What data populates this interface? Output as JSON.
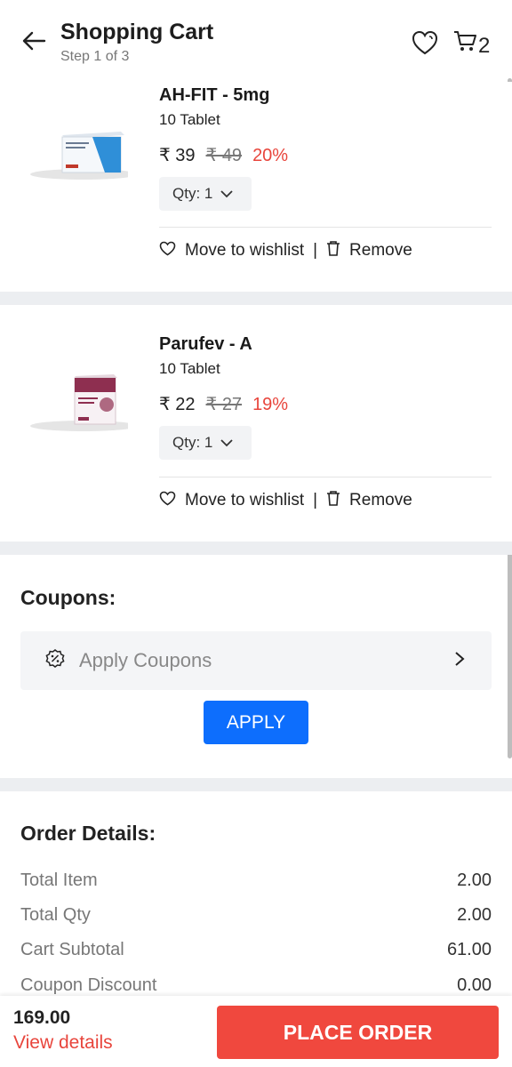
{
  "header": {
    "title": "Shopping Cart",
    "step": "Step 1 of 3",
    "cart_count": "2",
    "icons": [
      "back-arrow-icon",
      "heart-icon",
      "cart-icon"
    ]
  },
  "items": [
    {
      "name": "AH-FIT - 5mg",
      "pack": "10 Tablet",
      "price": "₹ 39",
      "mrp": "₹ 49",
      "discount": "20%",
      "qty": "Qty: 1",
      "wishlist": "Move to wishlist",
      "separator": "|",
      "remove": "Remove",
      "box_color": "#2f8fd8"
    },
    {
      "name": "Parufev - A",
      "pack": "10 Tablet",
      "price": "₹ 22",
      "mrp": "₹ 27",
      "discount": "19%",
      "qty": "Qty: 1",
      "wishlist": "Move to wishlist",
      "separator": "|",
      "remove": "Remove",
      "box_color": "#8e2f50"
    }
  ],
  "coupons": {
    "title": "Coupons:",
    "placeholder": "Apply Coupons",
    "apply": "APPLY"
  },
  "order": {
    "title": "Order Details:",
    "rows": [
      {
        "label": "Total Item",
        "value": "2.00"
      },
      {
        "label": "Total Qty",
        "value": "2.00"
      },
      {
        "label": "Cart Subtotal",
        "value": "61.00"
      },
      {
        "label": "Coupon Discount",
        "value": "0.00"
      }
    ]
  },
  "footer": {
    "total": "169.00",
    "view_details": "View details",
    "place_order": "PLACE ORDER"
  },
  "colors": {
    "accent_blue": "#0d6efd",
    "accent_red": "#f0483e",
    "discount_red": "#e8453c"
  }
}
